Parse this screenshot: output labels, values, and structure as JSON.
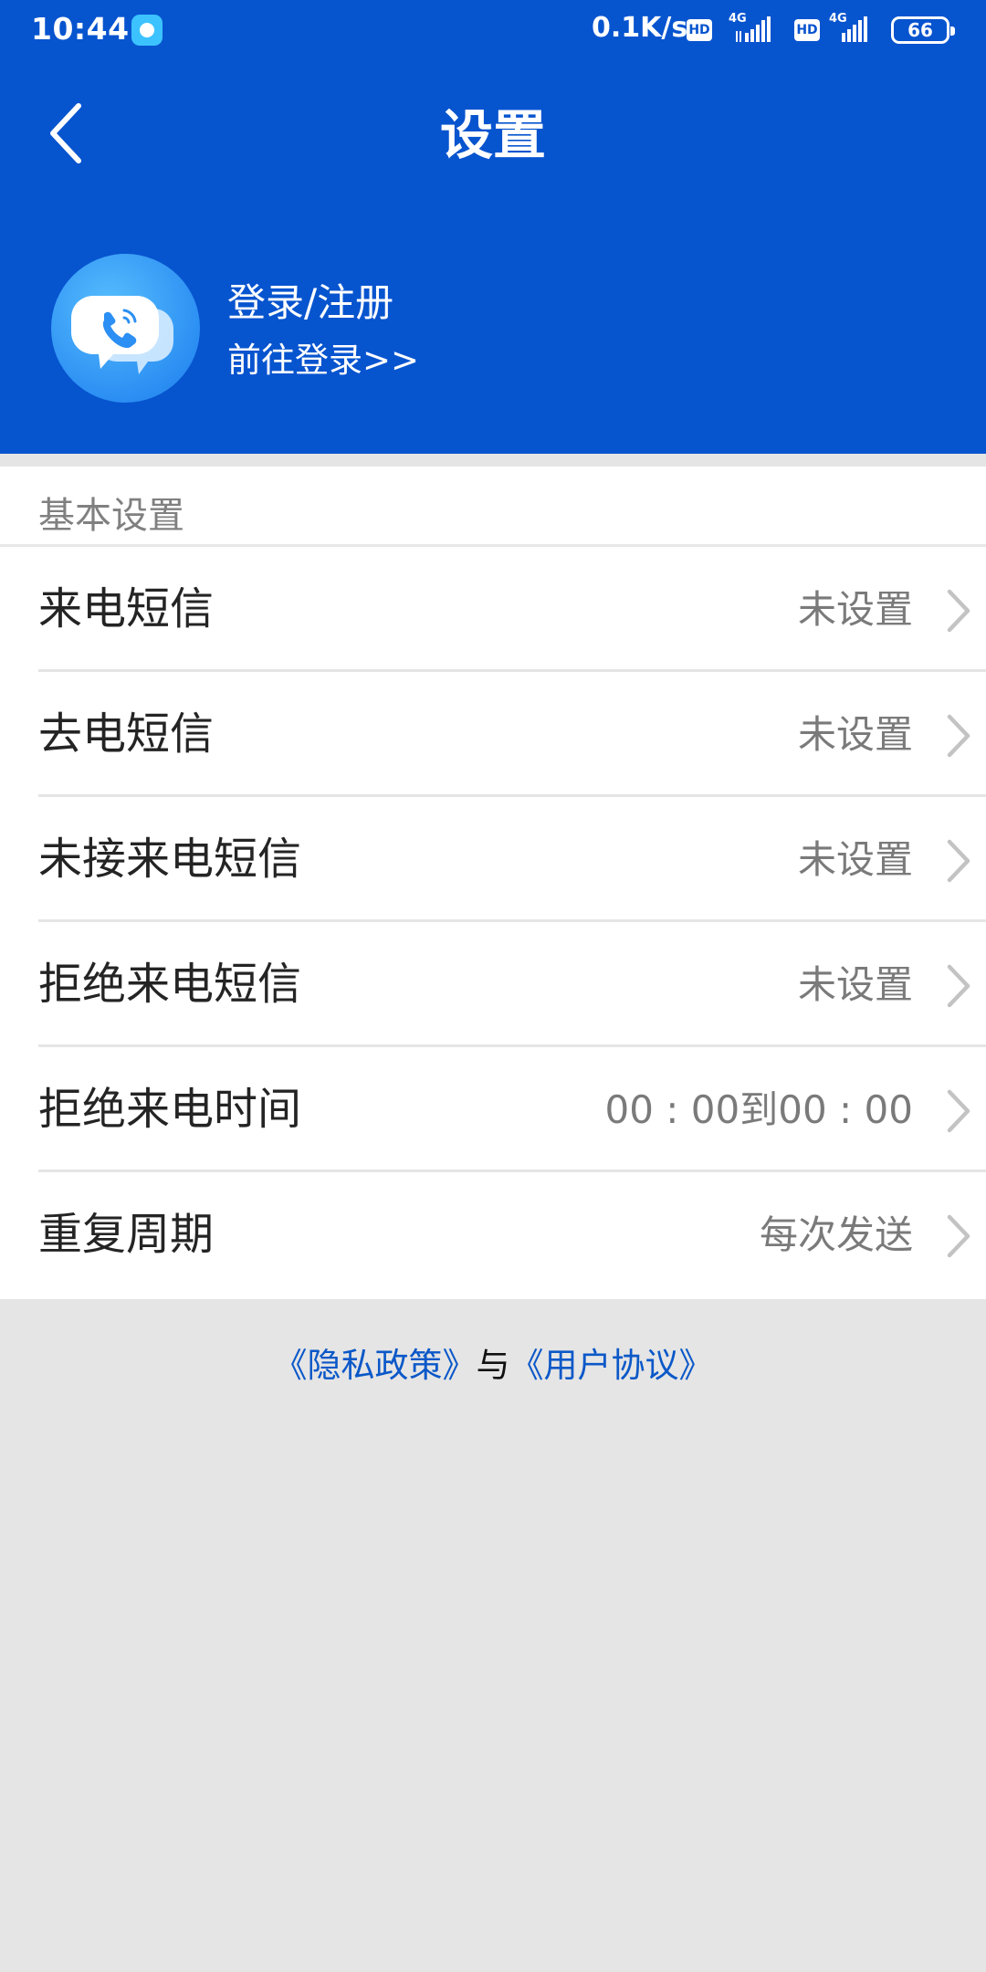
{
  "status_bar": {
    "time": "10:44",
    "net_speed": "0.1K/s",
    "hd_label": "HD",
    "net_type": "4G",
    "battery_level": "66"
  },
  "header": {
    "title": "设置",
    "bg_color": "#0754cf"
  },
  "account": {
    "title": "登录/注册",
    "link": "前往登录>>"
  },
  "settings": {
    "section_title": "基本设置",
    "rows": [
      {
        "label": "来电短信",
        "value": "未设置"
      },
      {
        "label": "去电短信",
        "value": "未设置"
      },
      {
        "label": "未接来电短信",
        "value": "未设置"
      },
      {
        "label": "拒绝来电短信",
        "value": "未设置"
      },
      {
        "label": "拒绝来电时间",
        "value": "00 : 00到00 : 00"
      },
      {
        "label": "重复周期",
        "value": "每次发送"
      }
    ]
  },
  "footer": {
    "privacy_link": "《隐私政策》",
    "conjunction": "与",
    "agreement_link": "《用户协议》",
    "link_color": "#0b58c8"
  },
  "icons": {
    "back": "back-arrow-icon",
    "chevron": "chevron-right-icon",
    "avatar": "phone-chat-bubble-icon"
  }
}
